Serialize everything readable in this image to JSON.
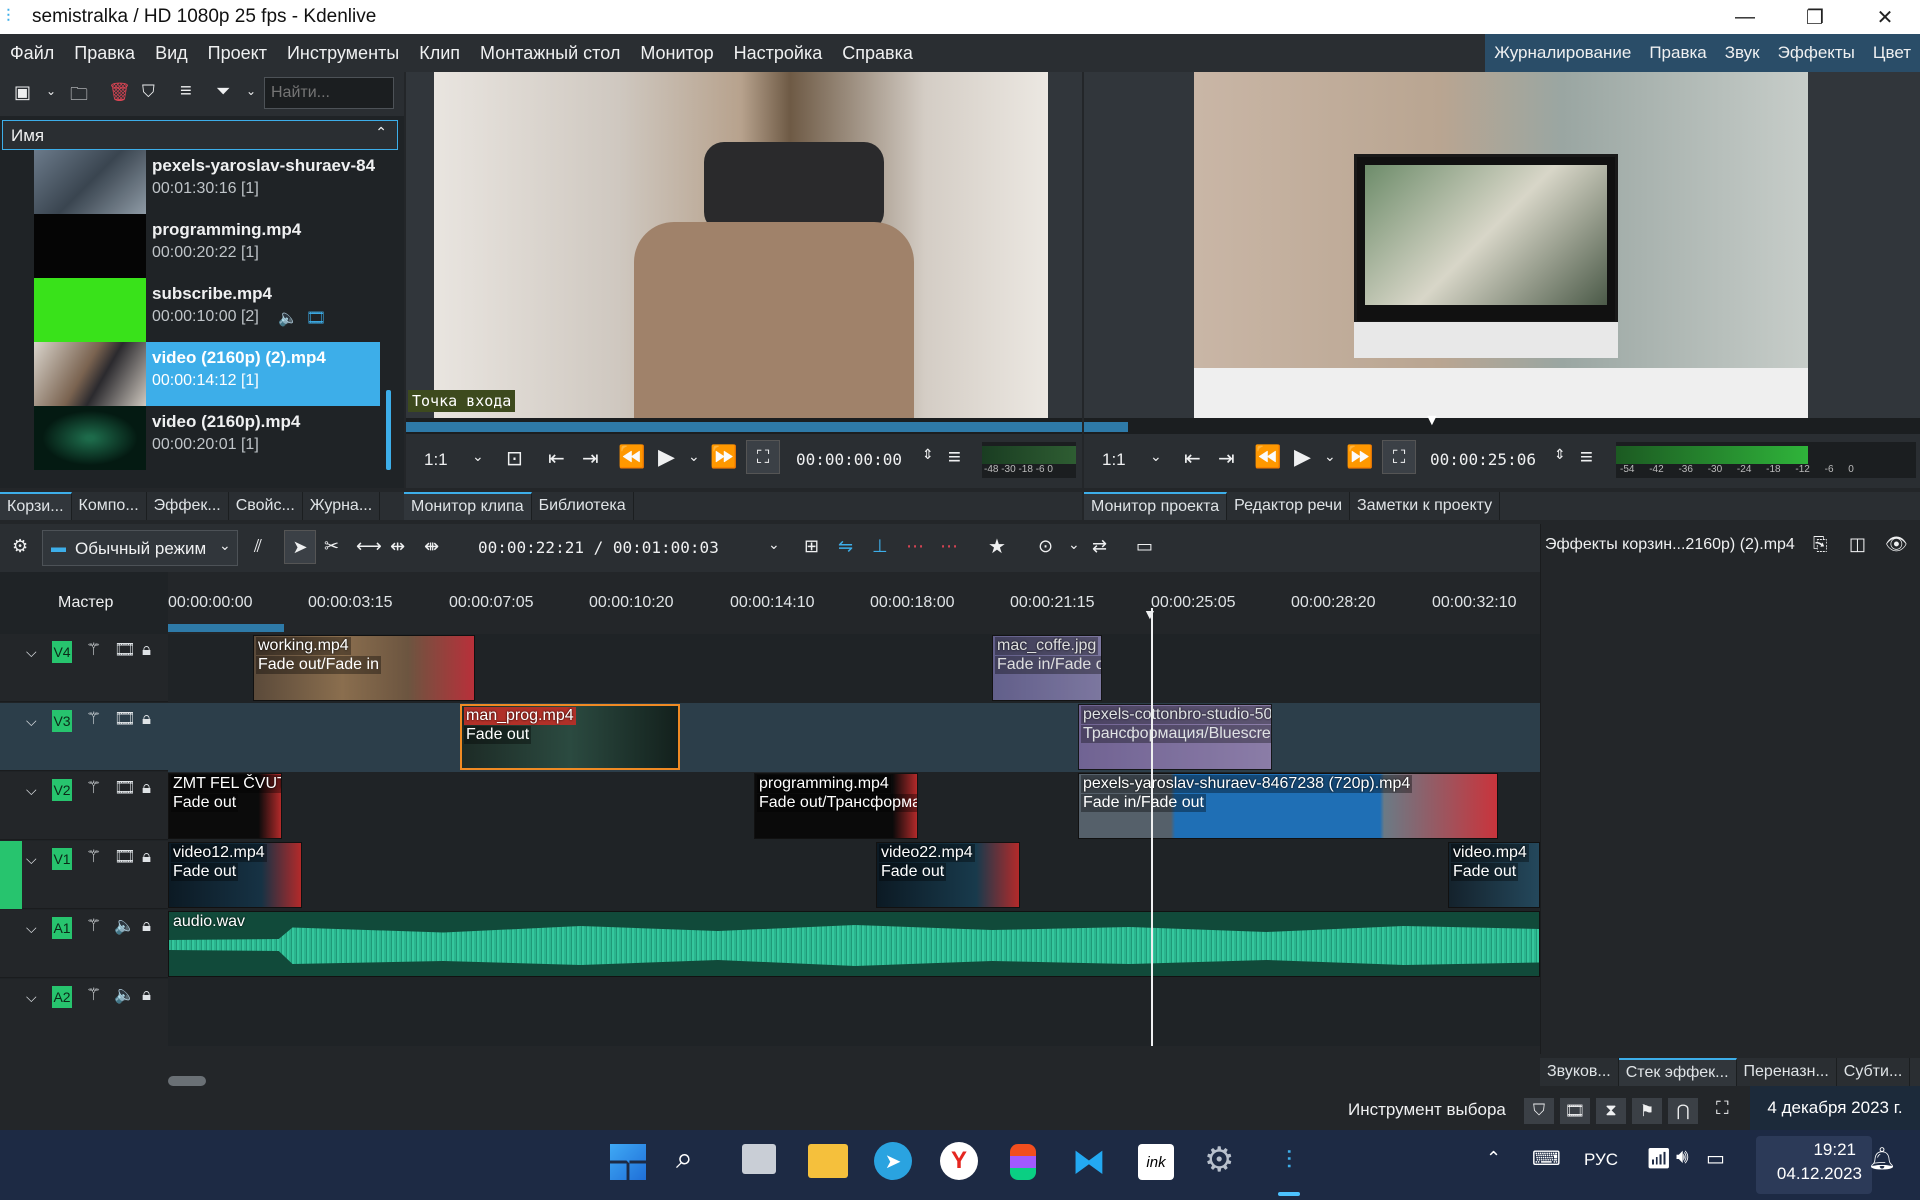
{
  "window": {
    "title": "semistralka / HD 1080p 25 fps - Kdenlive",
    "minimize": "—",
    "maximize": "❐",
    "close": "✕"
  },
  "menu": [
    "Файл",
    "Правка",
    "Вид",
    "Проект",
    "Инструменты",
    "Клип",
    "Монтажный стол",
    "Монитор",
    "Настройка",
    "Справка"
  ],
  "layouts": [
    "Журналирование",
    "Правка",
    "Звук",
    "Эффекты",
    "Цвет"
  ],
  "bin": {
    "search_placeholder": "Найти...",
    "column_header": "Имя",
    "items": [
      {
        "name": "pexels-yaroslav-shuraev-84",
        "duration": "00:01:30:16 [1]"
      },
      {
        "name": "programming.mp4",
        "duration": "00:00:20:22 [1]"
      },
      {
        "name": "subscribe.mp4",
        "duration": "00:00:10:00 [2]"
      },
      {
        "name": "video (2160p) (2).mp4",
        "duration": "00:00:14:12 [1]"
      },
      {
        "name": "video (2160p).mp4",
        "duration": "00:00:20:01 [1]"
      }
    ],
    "tabs": [
      "Корзи...",
      "Компо...",
      "Эффек...",
      "Свойс...",
      "Журна..."
    ]
  },
  "clip_monitor": {
    "inpoint_label": "Точка входа",
    "zoom": "1:1",
    "timecode": "00:00:00:00",
    "meter_scale": "-48 -30 -18 -6 0",
    "tabs": [
      "Монитор клипа",
      "Библиотека"
    ]
  },
  "project_monitor": {
    "zoom": "1:1",
    "timecode": "00:00:25:06",
    "meter_scale": "-54 -42 -36 -30 -24 -18 -12 -6 0",
    "tabs": [
      "Монитор проекта",
      "Редактор речи",
      "Заметки к проекту"
    ]
  },
  "timeline_toolbar": {
    "mode": "Обычный режим",
    "position": "00:00:22:21 / 00:01:00:03"
  },
  "timeline": {
    "master_label": "Мастер",
    "ruler": [
      "00:00:00:00",
      "00:00:03:15",
      "00:00:07:05",
      "00:00:10:20",
      "00:00:14:10",
      "00:00:18:00",
      "00:00:21:15",
      "00:00:25:05",
      "00:00:28:20",
      "00:00:32:10"
    ],
    "tracks": [
      {
        "tag": "V4",
        "clips": [
          {
            "name": "working.mp4",
            "effect": "Fade out/Fade in"
          },
          {
            "name": "mac_coffe.jpg",
            "effect": "Fade in/Fade out"
          }
        ]
      },
      {
        "tag": "V3",
        "clips": [
          {
            "name": "man_prog.mp4",
            "effect": "Fade out"
          },
          {
            "name": "pexels-cottonbro-studio-50",
            "effect": "Трансформация/Bluescreen"
          }
        ]
      },
      {
        "tag": "V2",
        "clips": [
          {
            "name": "ZMT FEL ČVUT",
            "effect": "Fade out"
          },
          {
            "name": "programming.mp4",
            "effect": "Fade out/Трансформация"
          },
          {
            "name": "pexels-yaroslav-shuraev-8467238 (720p).mp4",
            "effect": "Fade in/Fade out"
          }
        ]
      },
      {
        "tag": "V1",
        "clips": [
          {
            "name": "video12.mp4",
            "effect": "Fade out"
          },
          {
            "name": "video22.mp4",
            "effect": "Fade out"
          },
          {
            "name": "video.mp4",
            "effect": "Fade out"
          }
        ]
      },
      {
        "tag": "A1",
        "clips": [
          {
            "name": "audio.wav",
            "effect": ""
          }
        ]
      },
      {
        "tag": "A2",
        "clips": []
      }
    ]
  },
  "effects_panel": {
    "title": "Эффекты корзин...2160p) (2).mp4",
    "tabs": [
      "Звуков...",
      "Стек эффек...",
      "Переназн...",
      "Субти..."
    ]
  },
  "status": {
    "tool": "Инструмент выбора"
  },
  "taskbar": {
    "date_long": "4 декабря 2023 г.",
    "lang": "РУС",
    "time": "19:21",
    "date": "04.12.2023"
  },
  "colors": {
    "accent": "#3daee9",
    "track_tag": "#27c46e",
    "audio_wave": "#2bb58e",
    "selected_clip_border": "#f08a24"
  }
}
